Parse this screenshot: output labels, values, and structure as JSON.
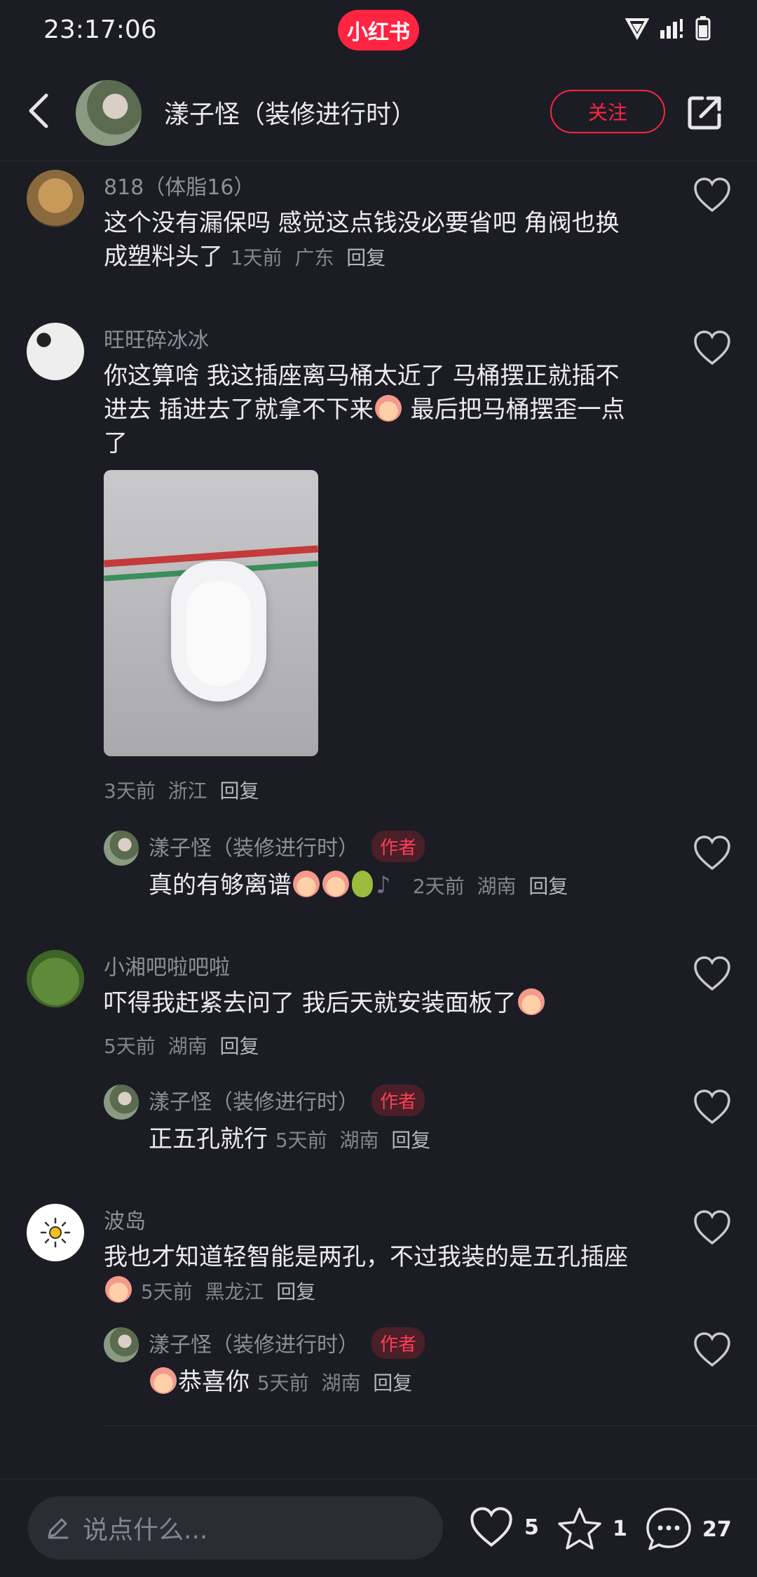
{
  "status_bar": {
    "time": "23:17:06",
    "app_badge": "小红书"
  },
  "header": {
    "title": "漾子怪（装修进行时）",
    "follow_label": "关注"
  },
  "comments": [
    {
      "name": "818（体脂16）",
      "text_line1": "这个没有漏保吗 感觉这点钱没必要省吧 角阀也换",
      "text_line2": "成塑料头了",
      "meta": {
        "time": "1天前",
        "location": "广东",
        "reply": "回复"
      }
    },
    {
      "name": "旺旺碎冰冰",
      "text_line1": "你这算啥 我这插座离马桶太近了 马桶摆正就插不",
      "text_line2a": "进去 插进去了就拿不下来",
      "text_line2b": " 最后把马桶摆歪一点",
      "text_line3": "了",
      "meta": {
        "time": "3天前",
        "location": "浙江",
        "reply": "回复"
      },
      "reply": {
        "name": "漾子怪（装修进行时）",
        "author_tag": "作者",
        "text": "真的有够离谱",
        "meta": {
          "time": "2天前",
          "location": "湖南",
          "reply": "回复"
        }
      }
    },
    {
      "name": "小湘吧啦吧啦",
      "text": "吓得我赶紧去问了 我后天就安装面板了",
      "meta": {
        "time": "5天前",
        "location": "湖南",
        "reply": "回复"
      },
      "reply": {
        "name": "漾子怪（装修进行时）",
        "author_tag": "作者",
        "text": "正五孔就行",
        "meta": {
          "time": "5天前",
          "location": "湖南",
          "reply": "回复"
        }
      }
    },
    {
      "name": "波岛",
      "text": "我也才知道轻智能是两孔，不过我装的是五孔插座",
      "meta": {
        "time": "5天前",
        "location": "黑龙江",
        "reply": "回复"
      },
      "reply": {
        "name": "漾子怪（装修进行时）",
        "author_tag": "作者",
        "text": "恭喜你",
        "meta": {
          "time": "5天前",
          "location": "湖南",
          "reply": "回复"
        }
      }
    }
  ],
  "bottom_bar": {
    "placeholder": "说点什么...",
    "likes": "5",
    "stars": "1",
    "comments": "27"
  },
  "colors": {
    "accent": "#ff2442",
    "background": "#1c1c24"
  }
}
